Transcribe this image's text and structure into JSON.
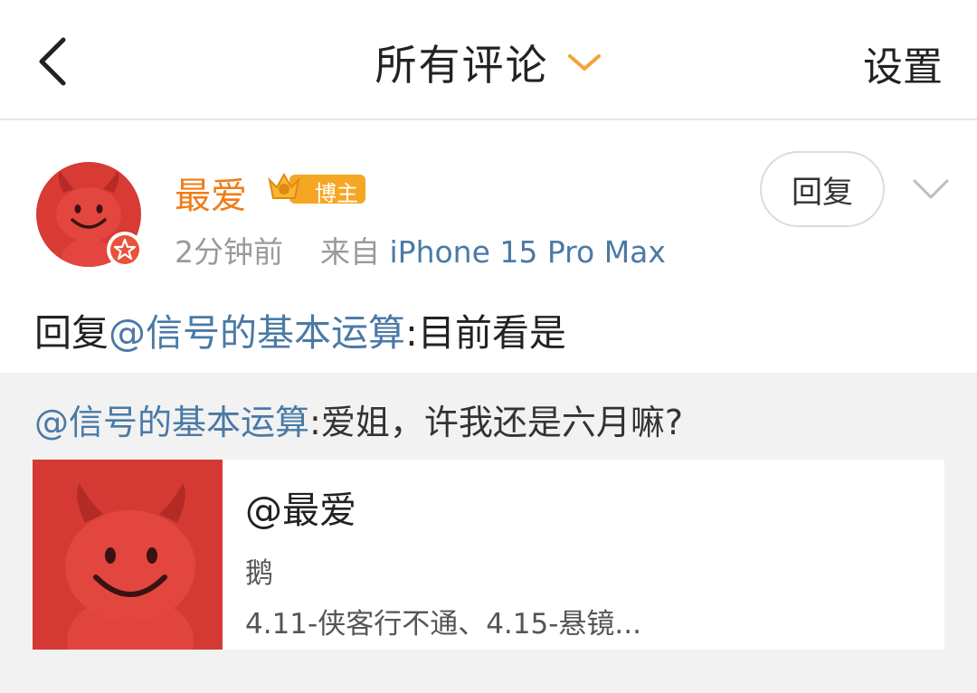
{
  "header": {
    "title": "所有评论",
    "settings_label": "设置"
  },
  "comment": {
    "username": "最爱",
    "badge_label": "博主",
    "time": "2分钟前",
    "source_prefix": "来自",
    "device": "iPhone 15 Pro Max",
    "reply_button": "回复",
    "text_prefix": "回复",
    "mention": "@信号的基本运算",
    "text_suffix": ":目前看是"
  },
  "quoted": {
    "mention": "@信号的基本运算",
    "text": ":爱姐，许我还是六月嘛?",
    "card": {
      "title": "@最爱",
      "line1": "鹅",
      "line2": "4.11-侠客行不通、4.15-悬镜..."
    }
  },
  "colors": {
    "accent_orange": "#f07c16",
    "link_blue": "#4a7aa6",
    "avatar_red": "#d83a34"
  },
  "icons": [
    "back-arrow-icon",
    "chevron-down-icon",
    "verified-badge-icon",
    "crown-icon",
    "more-chevron-icon"
  ]
}
